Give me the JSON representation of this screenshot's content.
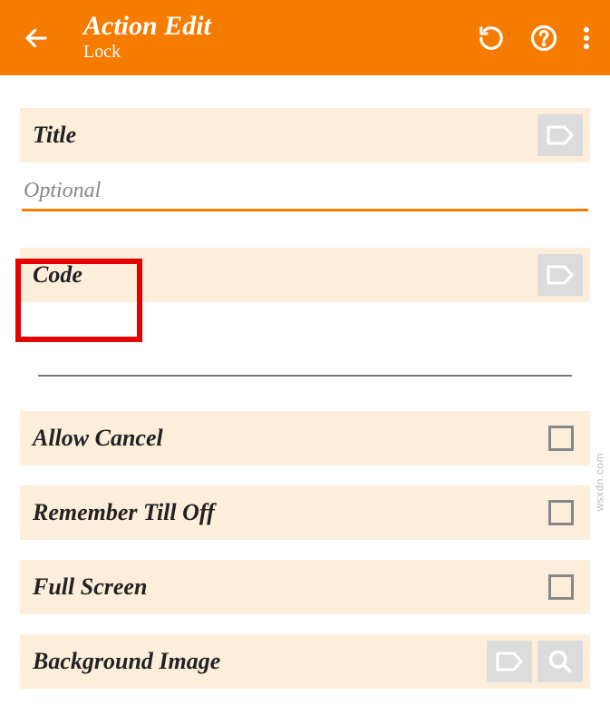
{
  "header": {
    "title": "Action Edit",
    "subtitle": "Lock"
  },
  "fields": {
    "title_label": "Title",
    "title_placeholder": "Optional",
    "title_value": "",
    "code_label": "Code",
    "allow_cancel_label": "Allow Cancel",
    "remember_label": "Remember Till Off",
    "fullscreen_label": "Full Screen",
    "bgimage_label": "Background Image"
  },
  "watermark": "wsxdn.com"
}
